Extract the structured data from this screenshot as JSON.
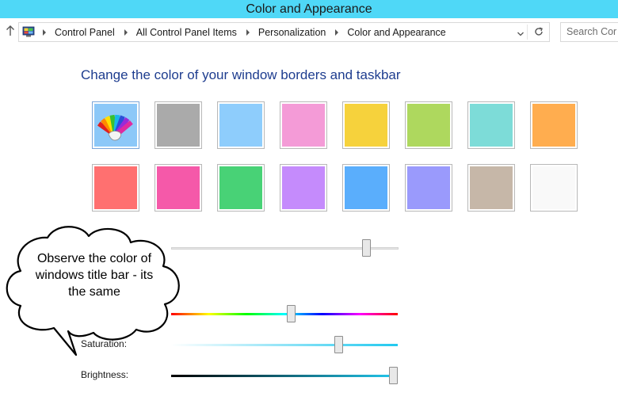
{
  "window": {
    "title": "Color and Appearance"
  },
  "address": {
    "breadcrumbs": [
      "Control Panel",
      "All Control Panel Items",
      "Personalization",
      "Color and Appearance"
    ],
    "search_placeholder": "Search Cor",
    "icons": [
      "up-arrow-icon",
      "control-panel-icon",
      "chevron-down-icon",
      "refresh-icon"
    ]
  },
  "main": {
    "heading": "Change the color of your window borders and taskbar",
    "swatches_row1": [
      "#8cc8f8",
      "#aaaaaa",
      "#8ecdfc",
      "#f49bd7",
      "#f6d23c",
      "#aed85e",
      "#7ddcd8",
      "#ffad4f"
    ],
    "swatches_row2": [
      "#ff7070",
      "#f559a9",
      "#48d276",
      "#c58bfc",
      "#5aaefc",
      "#9a9afc",
      "#c6b7a8",
      "#f9f9f9"
    ],
    "selected_swatch_icon": "color-palette-icon"
  },
  "sliders": {
    "intensity": {
      "value": 0.86
    },
    "hue": {
      "value": 0.53
    },
    "saturation": {
      "label": "Saturation:",
      "value": 0.74
    },
    "brightness": {
      "label": "Brightness:",
      "value": 0.98
    }
  },
  "callout": {
    "text": "Observe the color of windows title bar - its the same"
  }
}
